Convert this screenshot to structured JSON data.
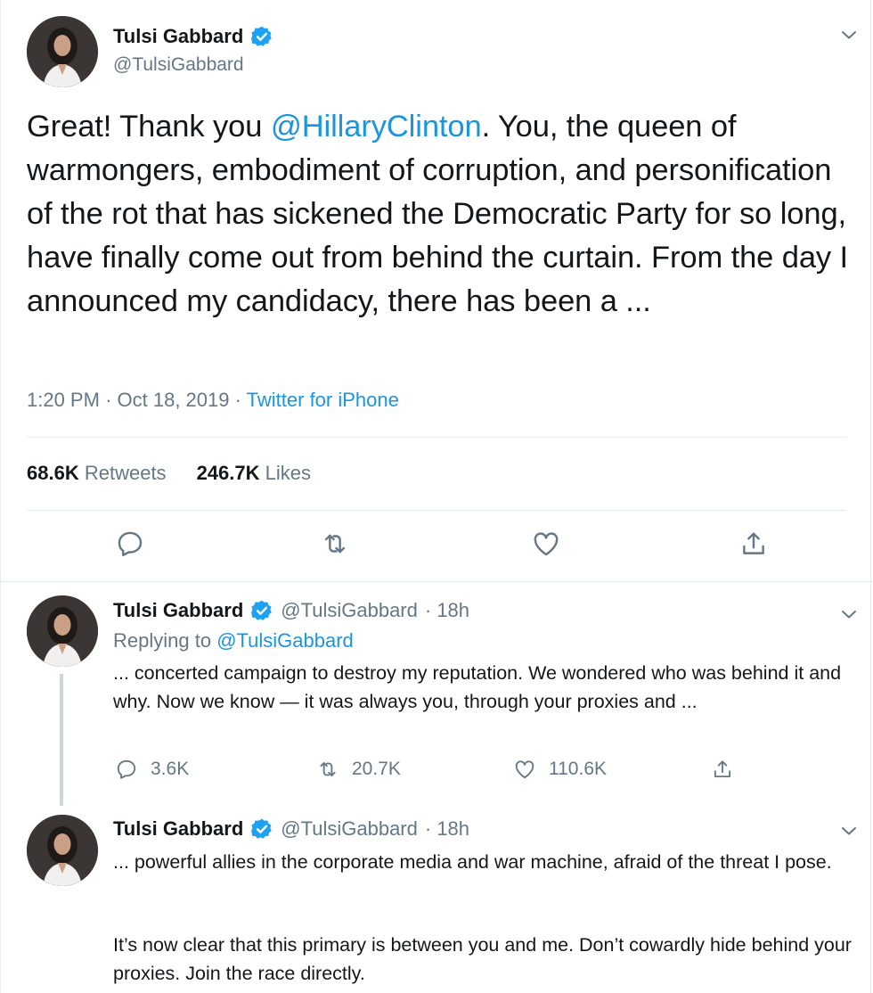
{
  "main_tweet": {
    "author_name": "Tulsi Gabbard",
    "author_handle": "@TulsiGabbard",
    "text_part1": "Great! Thank you ",
    "mention": "@HillaryClinton",
    "text_part2": ". You, the queen of warmongers, embodiment of corruption, and personification of the rot that has sickened the Democratic Party for so long, have finally come out from behind the curtain. From the day I announced my candidacy, there has been a ...",
    "time": "1:20 PM",
    "date": "Oct 18, 2019",
    "separator": "·",
    "source": "Twitter for iPhone",
    "retweets_count": "68.6K",
    "retweets_label": "Retweets",
    "likes_count": "246.7K",
    "likes_label": "Likes",
    "icons": [
      "reply-icon",
      "retweet-icon",
      "like-icon",
      "share-icon"
    ]
  },
  "replies": [
    {
      "author_name": "Tulsi Gabbard",
      "author_handle": "@TulsiGabbard",
      "age": "· 18h",
      "replying_to_label": "Replying to ",
      "replying_to_handle": "@TulsiGabbard",
      "text": "... concerted campaign to destroy my reputation. We wondered who was behind it and why. Now we know — it was always you, through your proxies and ...",
      "reply_count": "3.6K",
      "retweet_count": "20.7K",
      "like_count": "110.6K"
    },
    {
      "author_name": "Tulsi Gabbard",
      "author_handle": "@TulsiGabbard",
      "age": "· 18h",
      "text_p1": "... powerful allies in the corporate media and war machine, afraid of the threat I pose.",
      "text_p2": "It’s now clear that this primary is between you and me. Don’t cowardly hide behind your proxies. Join the race directly."
    }
  ],
  "colors": {
    "accent": "#1b95e0",
    "verified": "#1da1f2",
    "muted": "#657786",
    "text": "#14171a",
    "divider": "#e6ecf0"
  }
}
